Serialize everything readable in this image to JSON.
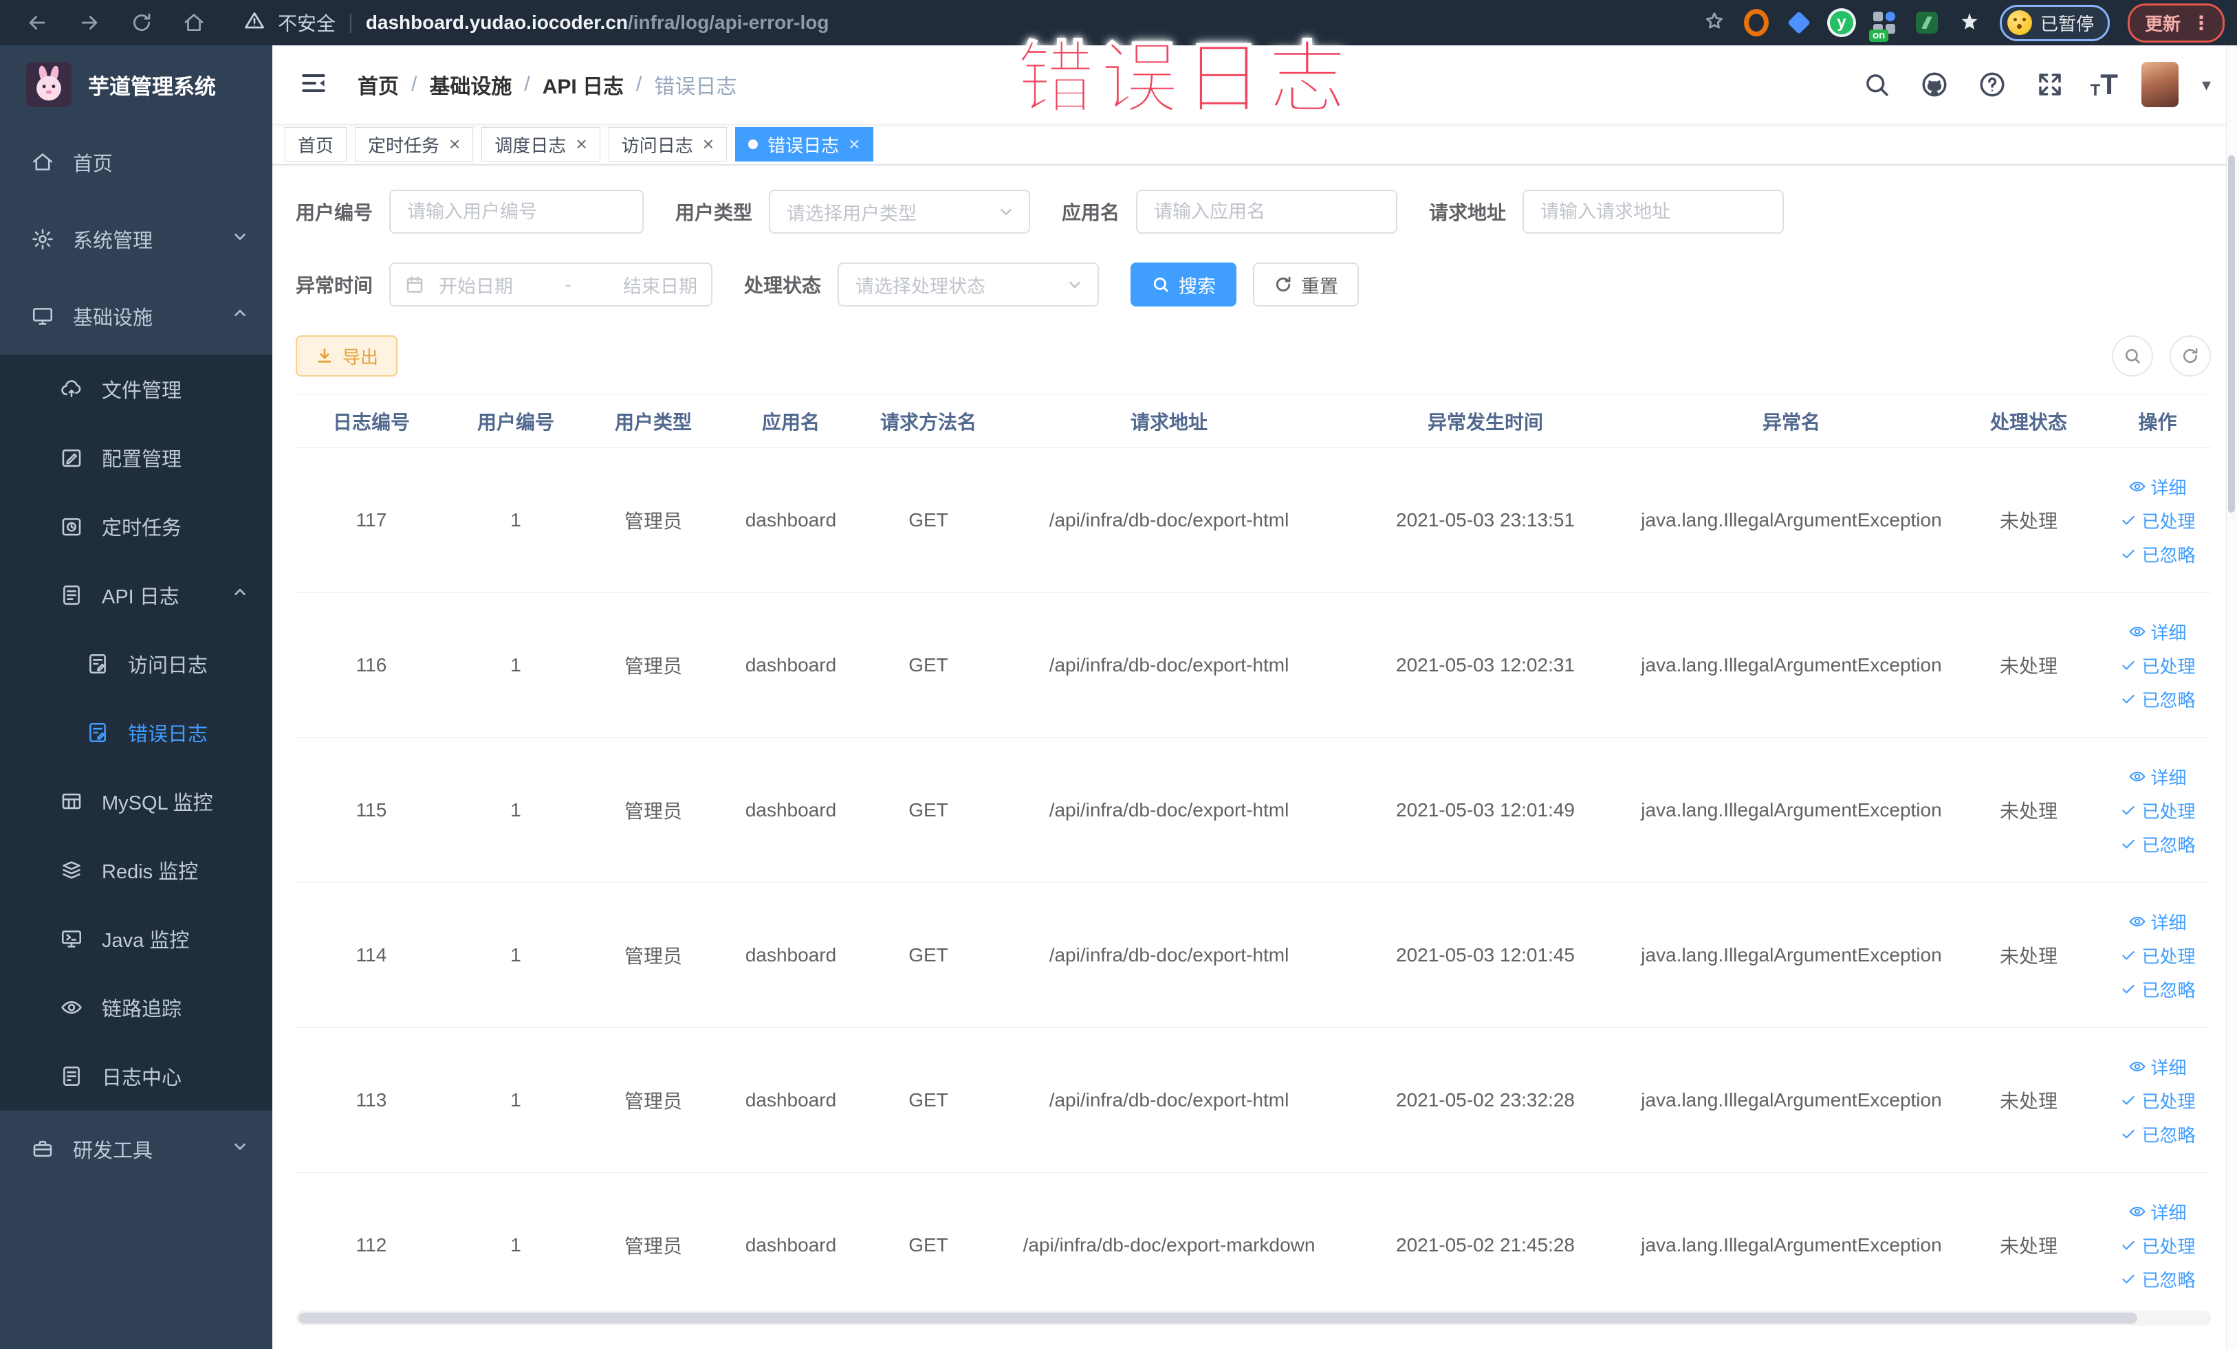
{
  "colors": {
    "accent": "#409eff",
    "warning": "#e6a23c",
    "sidebar_bg": "#304156",
    "submenu_bg": "#1f2d3d",
    "watermark": "#f0455f"
  },
  "watermark": {
    "text": "错误日志"
  },
  "browser": {
    "security_warning": "不安全",
    "url_domain": "dashboard.yudao.iocoder.cn",
    "url_path": "/infra/log/api-error-log",
    "extension_y_letter": "y",
    "grid_on_badge": "on",
    "paused_badge": "已暂停",
    "update_button": "更新",
    "menu_dots": "⋮"
  },
  "sidebar": {
    "title": "芋道管理系统",
    "items": [
      {
        "key": "home",
        "label": "首页",
        "icon": "home",
        "level": 0
      },
      {
        "key": "system-mgmt",
        "label": "系统管理",
        "icon": "gear",
        "level": 0,
        "chevron": "down"
      },
      {
        "key": "infrastructure",
        "label": "基础设施",
        "icon": "monitor",
        "level": 0,
        "chevron": "up"
      },
      {
        "key": "file-mgmt",
        "label": "文件管理",
        "icon": "cloud",
        "level": 1,
        "dark": true
      },
      {
        "key": "config-mgmt",
        "label": "配置管理",
        "icon": "edit",
        "level": 1,
        "dark": true
      },
      {
        "key": "cron-job",
        "label": "定时任务",
        "icon": "timer",
        "level": 1,
        "dark": true
      },
      {
        "key": "api-log",
        "label": "API 日志",
        "icon": "api",
        "level": 1,
        "dark": true,
        "chevron": "up"
      },
      {
        "key": "access-log",
        "label": "访问日志",
        "icon": "doc",
        "level": 2,
        "dark": true
      },
      {
        "key": "error-log",
        "label": "错误日志",
        "icon": "doc",
        "level": 2,
        "dark": true,
        "active": true
      },
      {
        "key": "mysql-monitor",
        "label": "MySQL 监控",
        "icon": "mysql",
        "level": 1,
        "dark": true
      },
      {
        "key": "redis-monitor",
        "label": "Redis 监控",
        "icon": "redis",
        "level": 1,
        "dark": true
      },
      {
        "key": "java-monitor",
        "label": "Java 监控",
        "icon": "java",
        "level": 1,
        "dark": true
      },
      {
        "key": "tracing",
        "label": "链路追踪",
        "icon": "trace",
        "level": 1,
        "dark": true
      },
      {
        "key": "log-center",
        "label": "日志中心",
        "icon": "logcenter",
        "level": 1,
        "dark": true
      },
      {
        "key": "dev-tools",
        "label": "研发工具",
        "icon": "tools",
        "level": 0,
        "chevron": "down"
      }
    ]
  },
  "breadcrumb": {
    "items": [
      "首页",
      "基础设施",
      "API 日志",
      "错误日志"
    ],
    "separator": "/"
  },
  "tabs": {
    "items": [
      {
        "key": "home",
        "label": "首页",
        "closable": false,
        "active": false
      },
      {
        "key": "cron-job",
        "label": "定时任务",
        "closable": true,
        "active": false
      },
      {
        "key": "schedule-log",
        "label": "调度日志",
        "closable": true,
        "active": false
      },
      {
        "key": "access-log",
        "label": "访问日志",
        "closable": true,
        "active": false
      },
      {
        "key": "error-log",
        "label": "错误日志",
        "closable": true,
        "active": true
      }
    ]
  },
  "filters": {
    "user_id": {
      "label": "用户编号",
      "placeholder": "请输入用户编号"
    },
    "user_type": {
      "label": "用户类型",
      "placeholder": "请选择用户类型"
    },
    "app_name": {
      "label": "应用名",
      "placeholder": "请输入应用名"
    },
    "request_url": {
      "label": "请求地址",
      "placeholder": "请输入请求地址"
    },
    "exception_time": {
      "label": "异常时间",
      "start_placeholder": "开始日期",
      "separator": "-",
      "end_placeholder": "结束日期"
    },
    "process_status": {
      "label": "处理状态",
      "placeholder": "请选择处理状态"
    },
    "search_label": "搜索",
    "reset_label": "重置"
  },
  "toolbar": {
    "export_label": "导出"
  },
  "table": {
    "columns": [
      "日志编号",
      "用户编号",
      "用户类型",
      "应用名",
      "请求方法名",
      "请求地址",
      "异常发生时间",
      "异常名",
      "处理状态",
      "操作"
    ],
    "row_actions": [
      "详细",
      "已处理",
      "已忽略"
    ],
    "rows": [
      {
        "id": "117",
        "user_id": "1",
        "user_type": "管理员",
        "app": "dashboard",
        "method": "GET",
        "url": "/api/infra/db-doc/export-html",
        "time": "2021-05-03 23:13:51",
        "exception": "java.lang.IllegalArgumentException",
        "status": "未处理"
      },
      {
        "id": "116",
        "user_id": "1",
        "user_type": "管理员",
        "app": "dashboard",
        "method": "GET",
        "url": "/api/infra/db-doc/export-html",
        "time": "2021-05-03 12:02:31",
        "exception": "java.lang.IllegalArgumentException",
        "status": "未处理"
      },
      {
        "id": "115",
        "user_id": "1",
        "user_type": "管理员",
        "app": "dashboard",
        "method": "GET",
        "url": "/api/infra/db-doc/export-html",
        "time": "2021-05-03 12:01:49",
        "exception": "java.lang.IllegalArgumentException",
        "status": "未处理"
      },
      {
        "id": "114",
        "user_id": "1",
        "user_type": "管理员",
        "app": "dashboard",
        "method": "GET",
        "url": "/api/infra/db-doc/export-html",
        "time": "2021-05-03 12:01:45",
        "exception": "java.lang.IllegalArgumentException",
        "status": "未处理"
      },
      {
        "id": "113",
        "user_id": "1",
        "user_type": "管理员",
        "app": "dashboard",
        "method": "GET",
        "url": "/api/infra/db-doc/export-html",
        "time": "2021-05-02 23:32:28",
        "exception": "java.lang.IllegalArgumentException",
        "status": "未处理"
      },
      {
        "id": "112",
        "user_id": "1",
        "user_type": "管理员",
        "app": "dashboard",
        "method": "GET",
        "url": "/api/infra/db-doc/export-markdown",
        "time": "2021-05-02 21:45:28",
        "exception": "java.lang.IllegalArgumentException",
        "status": "未处理"
      }
    ]
  }
}
